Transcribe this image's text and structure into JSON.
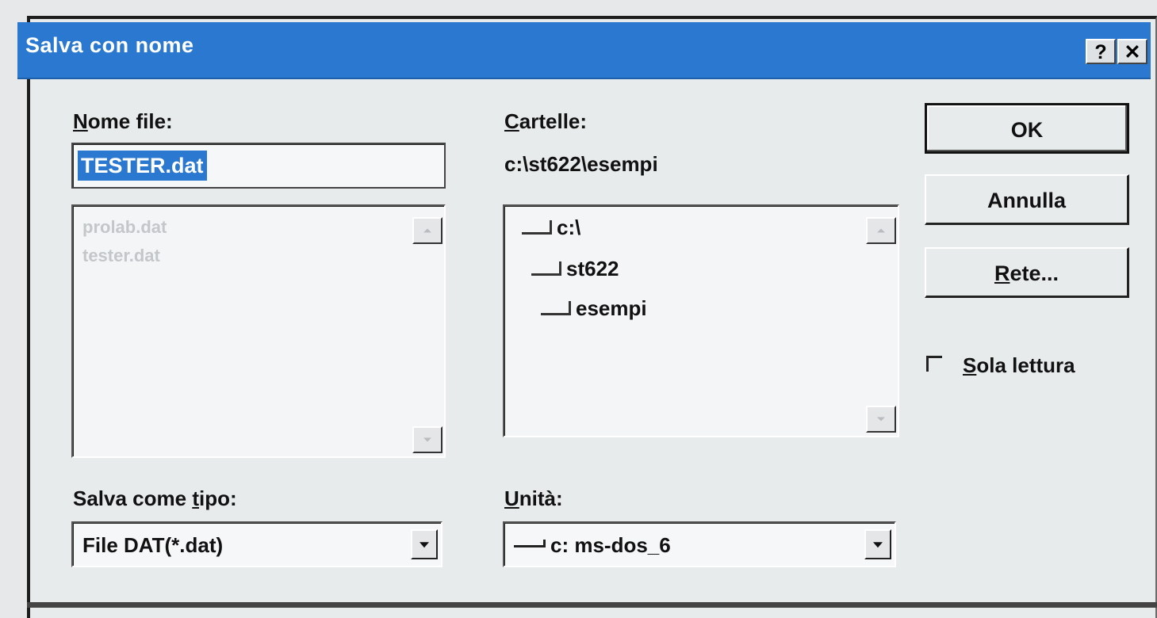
{
  "dialog": {
    "title": "Salva con nome",
    "help_button": "?",
    "close_button": "✕"
  },
  "filename": {
    "label_prefix": "",
    "label_ul": "N",
    "label_rest": "ome file:",
    "value": "TESTER.dat",
    "files": [
      "prolab.dat",
      "tester.dat"
    ]
  },
  "folders": {
    "label_ul": "C",
    "label_rest": "artelle:",
    "current_path": "c:\\st622\\esempi",
    "items": [
      "c:\\",
      "st622",
      "esempi"
    ]
  },
  "buttons": {
    "ok": "OK",
    "cancel": "Annulla",
    "network_ul": "R",
    "network_rest": "ete..."
  },
  "readonly": {
    "label_ul": "S",
    "label_rest": "ola lettura",
    "checked": false
  },
  "save_type": {
    "label_prefix": "Salva come ",
    "label_ul": "t",
    "label_rest": "ipo:",
    "value": "File DAT(*.dat)"
  },
  "drive": {
    "label_ul": "U",
    "label_rest": "nità:",
    "value": "c: ms-dos_6"
  }
}
